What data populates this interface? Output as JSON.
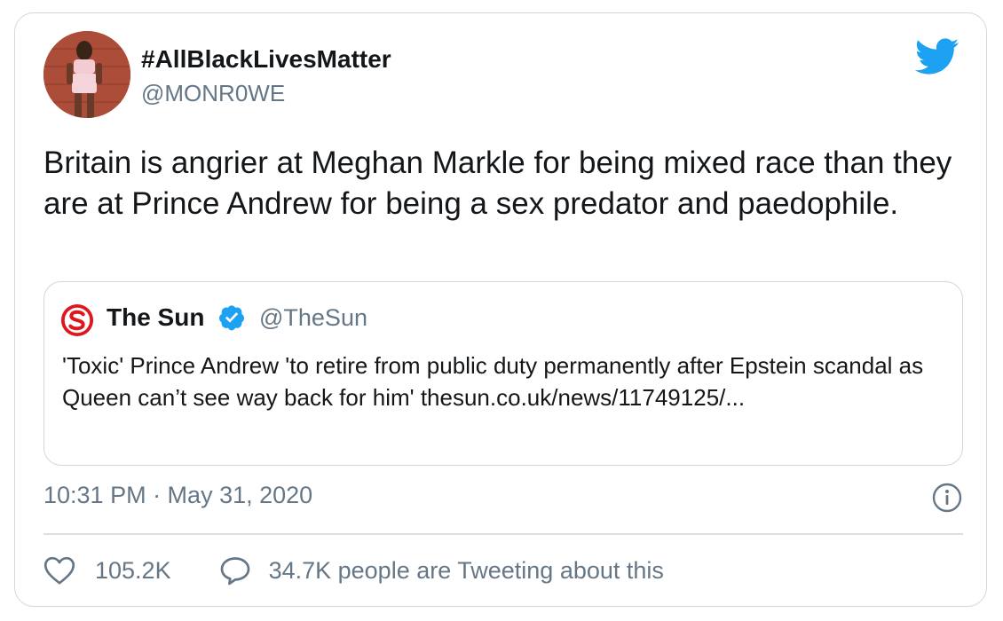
{
  "tweet": {
    "author": {
      "display_name": "#AllBlackLivesMatter",
      "handle": "@MONR0WE",
      "avatar": "profile-photo"
    },
    "text": "Britain is angrier at Meghan Markle for being mixed race than they are at Prince Andrew for being a sex predator and paedophile.",
    "timestamp": "10:31 PM · May 31, 2020",
    "like_count": "105.2K",
    "conversation_text": "34.7K people are Tweeting about this"
  },
  "quoted_tweet": {
    "author": {
      "display_name": "The Sun",
      "handle": "@TheSun",
      "verified": true,
      "logo": "the-sun-logo"
    },
    "text": "'Toxic' Prince Andrew 'to retire from public duty permanently after Epstein scandal as Queen can’t see way back for him' thesun.co.uk/news/11749125/..."
  },
  "icons": {
    "brand": "twitter-bird-icon",
    "info": "info-icon",
    "like": "heart-icon",
    "reply": "speech-bubble-icon",
    "verified": "verified-badge-icon"
  },
  "colors": {
    "twitter_blue": "#1da1f2",
    "secondary_text": "#657786",
    "border": "#cfd9de",
    "sun_red": "#e0161e"
  }
}
